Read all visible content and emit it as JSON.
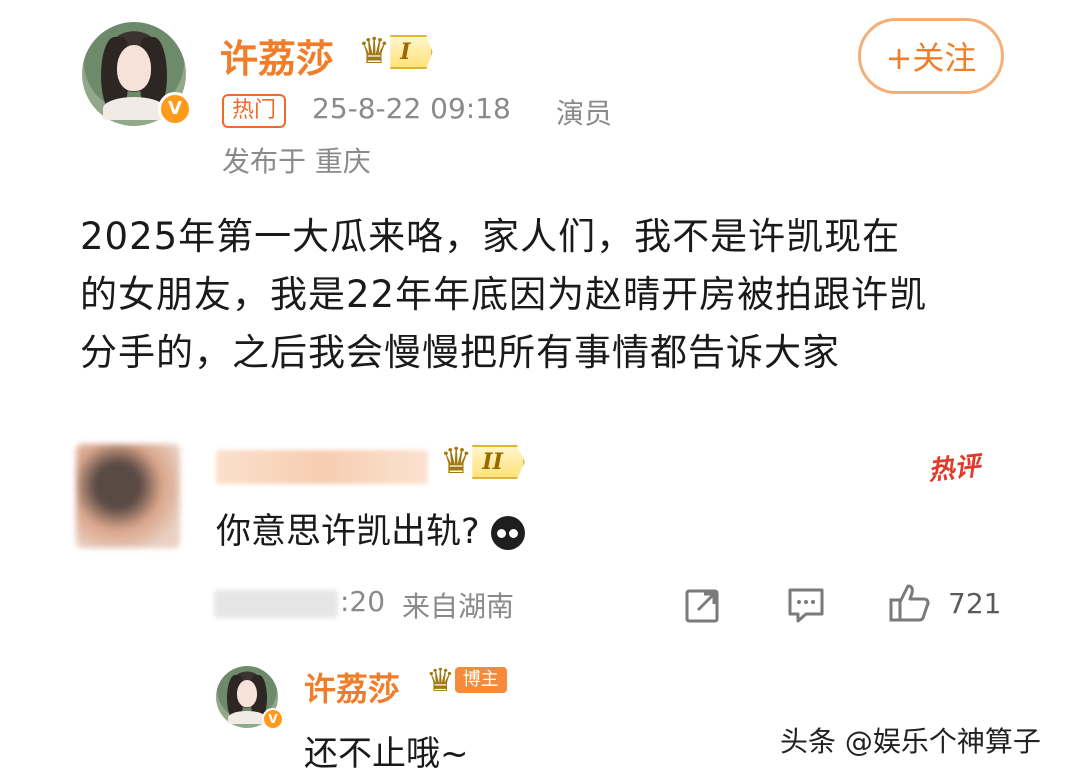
{
  "post": {
    "author": "许荔莎",
    "level_badge": "I",
    "hot_tag": "热门",
    "timestamp": "25-8-22 09:18",
    "role": "演员",
    "location": "发布于 重庆",
    "follow_label": "+关注",
    "body_lines": [
      "2025年第一大瓜来咯，家人们，我不是许凯现在",
      "的女朋友，我是22年年底因为赵晴开房被拍跟许凯",
      "分手的，之后我会慢慢把所有事情都告诉大家"
    ]
  },
  "comment": {
    "level_badge": "II",
    "hot_badge": "热评",
    "text": "你意思许凯出轨?",
    "time_suffix": ":20",
    "origin": "来自湖南",
    "like_count": "721"
  },
  "reply": {
    "author": "许荔莎",
    "owner_tag": "博主",
    "text": "还不止哦~"
  },
  "watermark": "头条 @娱乐个神算子",
  "icons": [
    "verified-v-icon",
    "crown-icon",
    "share-icon",
    "comment-icon",
    "like-icon",
    "emoji-icon"
  ],
  "colors": {
    "accent": "#f07d2a",
    "hot": "#e03a2a",
    "gold": "#e0b43a"
  }
}
